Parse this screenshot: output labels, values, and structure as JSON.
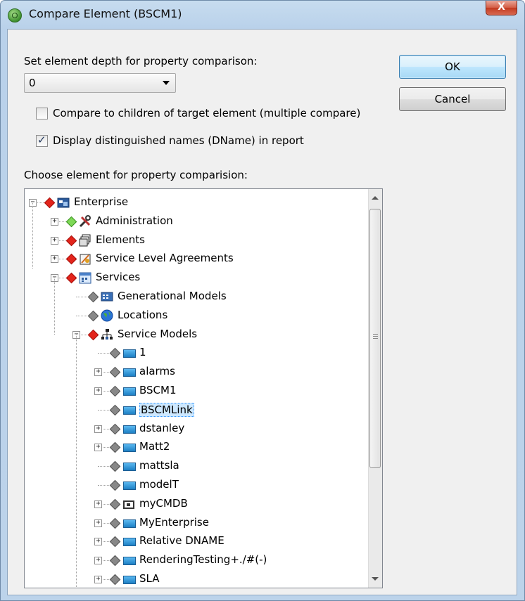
{
  "window": {
    "title": "Compare Element (BSCM1)",
    "close_glyph": "X"
  },
  "depth": {
    "label": "Set element depth for property comparison:",
    "value": "0"
  },
  "options": {
    "compare_children_label": "Compare to children of target element (multiple compare)",
    "compare_children_checked": false,
    "display_dname_label": "Display distinguished names (DName) in report",
    "display_dname_checked": true
  },
  "buttons": {
    "ok": "OK",
    "cancel": "Cancel"
  },
  "tree": {
    "label": "Choose element for property comparision:",
    "nodes": [
      {
        "label": "Enterprise",
        "expander": "−",
        "diamond": "red",
        "icon": "enterprise-icon"
      },
      {
        "label": "Administration",
        "expander": "+",
        "diamond": "green",
        "icon": "tools-icon"
      },
      {
        "label": "Elements",
        "expander": "+",
        "diamond": "red",
        "icon": "elements-icon"
      },
      {
        "label": "Service Level Agreements",
        "expander": "+",
        "diamond": "red",
        "icon": "sla-icon"
      },
      {
        "label": "Services",
        "expander": "−",
        "diamond": "red",
        "icon": "services-icon"
      },
      {
        "label": "Generational Models",
        "expander": "",
        "diamond": "gray",
        "icon": "generational-models-icon"
      },
      {
        "label": "Locations",
        "expander": "",
        "diamond": "gray",
        "icon": "globe-icon"
      },
      {
        "label": "Service Models",
        "expander": "−",
        "diamond": "red",
        "icon": "hierarchy-icon"
      },
      {
        "label": "1",
        "expander": "",
        "diamond": "gray",
        "icon": "service-model-icon"
      },
      {
        "label": "alarms",
        "expander": "+",
        "diamond": "gray",
        "icon": "service-model-icon"
      },
      {
        "label": "BSCM1",
        "expander": "+",
        "diamond": "gray",
        "icon": "service-model-icon"
      },
      {
        "label": "BSCMLink",
        "expander": "",
        "diamond": "gray",
        "icon": "service-model-icon",
        "selected": true
      },
      {
        "label": "dstanley",
        "expander": "+",
        "diamond": "gray",
        "icon": "service-model-icon"
      },
      {
        "label": "Matt2",
        "expander": "+",
        "diamond": "gray",
        "icon": "service-model-icon"
      },
      {
        "label": "mattsla",
        "expander": "",
        "diamond": "gray",
        "icon": "service-model-icon"
      },
      {
        "label": "modelT",
        "expander": "",
        "diamond": "gray",
        "icon": "service-model-icon"
      },
      {
        "label": "myCMDB",
        "expander": "+",
        "diamond": "gray",
        "icon": "cmdb-icon"
      },
      {
        "label": "MyEnterprise",
        "expander": "+",
        "diamond": "gray",
        "icon": "service-model-icon"
      },
      {
        "label": "Relative DNAME",
        "expander": "+",
        "diamond": "gray",
        "icon": "service-model-icon"
      },
      {
        "label": "RenderingTesting+./#(-)",
        "expander": "+",
        "diamond": "gray",
        "icon": "service-model-icon"
      },
      {
        "label": "SLA",
        "expander": "+",
        "diamond": "gray",
        "icon": "service-model-icon"
      }
    ]
  },
  "colors": {
    "default_button": "#bee6fd",
    "selection": "#cde8ff",
    "red_diamond": "#e3241b",
    "green_diamond": "#7ed957"
  }
}
